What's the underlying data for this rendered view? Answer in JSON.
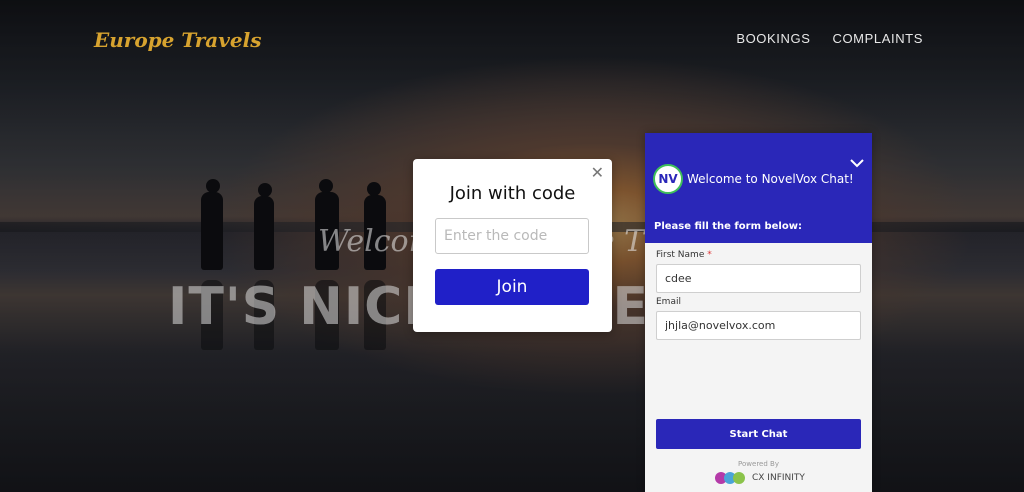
{
  "header": {
    "brand": "Europe Travels",
    "nav": [
      "BOOKINGS",
      "COMPLAINTS"
    ]
  },
  "hero": {
    "welcome_text": "Welcome to Europe Tra",
    "headline": "IT'S NICE TO MEET YOU"
  },
  "modal": {
    "close_icon": "close-icon",
    "title": "Join with code",
    "input_placeholder": "Enter the code",
    "join_label": "Join"
  },
  "chat": {
    "title": "Welcome to NovelVox Chat!",
    "logo_text": "NV",
    "subtitle": "Please fill the form below:",
    "first_name_label": "First Name",
    "required_mark": "*",
    "first_name_value": "cdee",
    "email_label": "Email",
    "email_value": "jhjla@novelvox.com",
    "start_label": "Start Chat",
    "powered_by": "Powered By",
    "brand": "CX INFINITY",
    "colors": {
      "accent": "#2a27b8",
      "join_button": "#2020c8"
    }
  }
}
